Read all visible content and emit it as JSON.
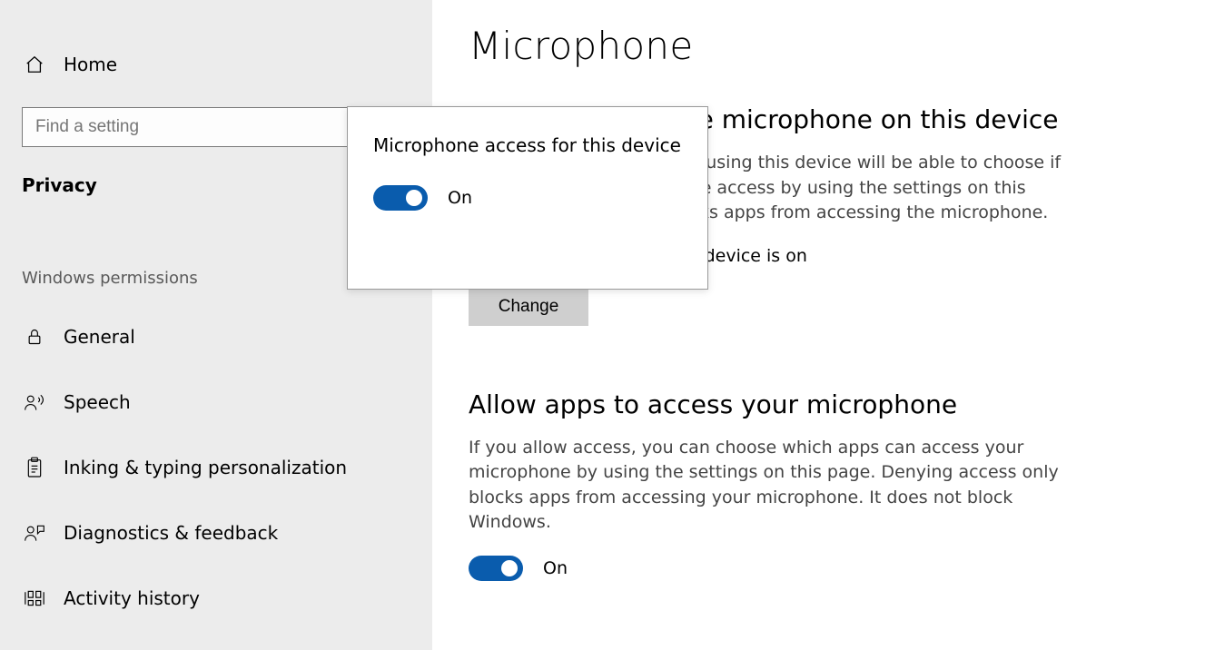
{
  "sidebar": {
    "home": "Home",
    "search_placeholder": "Find a setting",
    "current_category": "Privacy",
    "section_label": "Windows permissions",
    "items": [
      {
        "label": "General"
      },
      {
        "label": "Speech"
      },
      {
        "label": "Inking & typing personalization"
      },
      {
        "label": "Diagnostics & feedback"
      },
      {
        "label": "Activity history"
      }
    ]
  },
  "main": {
    "title": "Microphone",
    "allow_device_heading": "Allow access to the microphone on this device",
    "allow_device_body": "If you allow access, people using this device will be able to choose if their apps have microphone access by using the settings on this page. Denying access blocks apps from accessing the microphone.",
    "device_status_line": "Microphone access for this device is on",
    "change_label": "Change",
    "allow_apps_heading": "Allow apps to access your microphone",
    "allow_apps_body": "If you allow access, you can choose which apps can access your microphone by using the settings on this page. Denying access only blocks apps from accessing your microphone. It does not block Windows.",
    "apps_toggle_state": "On"
  },
  "popup": {
    "title": "Microphone access for this device",
    "toggle_state": "On"
  }
}
